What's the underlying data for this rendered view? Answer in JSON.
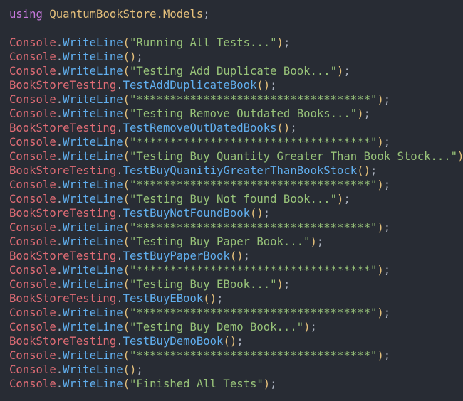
{
  "editor": {
    "colors": {
      "background": "#282c34",
      "keyword": "#c678dd",
      "namespace": "#e5c07b",
      "class": "#e06c75",
      "method": "#61afef",
      "string": "#98c379",
      "paren": "#e5c07b",
      "plain": "#abb2bf"
    },
    "lines": [
      {
        "tokens": [
          [
            "kw",
            "using"
          ],
          [
            "punc",
            " "
          ],
          [
            "ns",
            "QuantumBookStore.Models"
          ],
          [
            "punc",
            ";"
          ]
        ]
      },
      {
        "tokens": []
      },
      {
        "tokens": [
          [
            "cls",
            "Console"
          ],
          [
            "punc",
            "."
          ],
          [
            "fn",
            "WriteLine"
          ],
          [
            "paren",
            "("
          ],
          [
            "str",
            "\"Running All Tests...\""
          ],
          [
            "paren",
            ")"
          ],
          [
            "punc",
            ";"
          ]
        ]
      },
      {
        "tokens": [
          [
            "cls",
            "Console"
          ],
          [
            "punc",
            "."
          ],
          [
            "fn",
            "WriteLine"
          ],
          [
            "paren",
            "()"
          ],
          [
            "punc",
            ";"
          ]
        ]
      },
      {
        "tokens": [
          [
            "cls",
            "Console"
          ],
          [
            "punc",
            "."
          ],
          [
            "fn",
            "WriteLine"
          ],
          [
            "paren",
            "("
          ],
          [
            "str",
            "\"Testing Add Duplicate Book...\""
          ],
          [
            "paren",
            ")"
          ],
          [
            "punc",
            ";"
          ]
        ]
      },
      {
        "tokens": [
          [
            "cls",
            "BookStoreTesting"
          ],
          [
            "punc",
            "."
          ],
          [
            "fn",
            "TestAddDuplicateBook"
          ],
          [
            "paren",
            "()"
          ],
          [
            "punc",
            ";"
          ]
        ]
      },
      {
        "tokens": [
          [
            "cls",
            "Console"
          ],
          [
            "punc",
            "."
          ],
          [
            "fn",
            "WriteLine"
          ],
          [
            "paren",
            "("
          ],
          [
            "str",
            "\"***********************************\""
          ],
          [
            "paren",
            ")"
          ],
          [
            "punc",
            ";"
          ]
        ]
      },
      {
        "tokens": [
          [
            "cls",
            "Console"
          ],
          [
            "punc",
            "."
          ],
          [
            "fn",
            "WriteLine"
          ],
          [
            "paren",
            "("
          ],
          [
            "str",
            "\"Testing Remove Outdated Books...\""
          ],
          [
            "paren",
            ")"
          ],
          [
            "punc",
            ";"
          ]
        ]
      },
      {
        "tokens": [
          [
            "cls",
            "BookStoreTesting"
          ],
          [
            "punc",
            "."
          ],
          [
            "fn",
            "TestRemoveOutDatedBooks"
          ],
          [
            "paren",
            "()"
          ],
          [
            "punc",
            ";"
          ]
        ]
      },
      {
        "tokens": [
          [
            "cls",
            "Console"
          ],
          [
            "punc",
            "."
          ],
          [
            "fn",
            "WriteLine"
          ],
          [
            "paren",
            "("
          ],
          [
            "str",
            "\"***********************************\""
          ],
          [
            "paren",
            ")"
          ],
          [
            "punc",
            ";"
          ]
        ]
      },
      {
        "tokens": [
          [
            "cls",
            "Console"
          ],
          [
            "punc",
            "."
          ],
          [
            "fn",
            "WriteLine"
          ],
          [
            "paren",
            "("
          ],
          [
            "str",
            "\"Testing Buy Quantity Greater Than Book Stock...\""
          ],
          [
            "paren",
            ")"
          ],
          [
            "punc",
            ";"
          ]
        ]
      },
      {
        "tokens": [
          [
            "cls",
            "BookStoreTesting"
          ],
          [
            "punc",
            "."
          ],
          [
            "fn",
            "TestBuyQuanitiyGreaterThanBookStock"
          ],
          [
            "paren",
            "()"
          ],
          [
            "punc",
            ";"
          ]
        ]
      },
      {
        "tokens": [
          [
            "cls",
            "Console"
          ],
          [
            "punc",
            "."
          ],
          [
            "fn",
            "WriteLine"
          ],
          [
            "paren",
            "("
          ],
          [
            "str",
            "\"***********************************\""
          ],
          [
            "paren",
            ")"
          ],
          [
            "punc",
            ";"
          ]
        ]
      },
      {
        "tokens": [
          [
            "cls",
            "Console"
          ],
          [
            "punc",
            "."
          ],
          [
            "fn",
            "WriteLine"
          ],
          [
            "paren",
            "("
          ],
          [
            "str",
            "\"Testing Buy Not found Book...\""
          ],
          [
            "paren",
            ")"
          ],
          [
            "punc",
            ";"
          ]
        ]
      },
      {
        "tokens": [
          [
            "cls",
            "BookStoreTesting"
          ],
          [
            "punc",
            "."
          ],
          [
            "fn",
            "TestBuyNotFoundBook"
          ],
          [
            "paren",
            "()"
          ],
          [
            "punc",
            ";"
          ]
        ]
      },
      {
        "tokens": [
          [
            "cls",
            "Console"
          ],
          [
            "punc",
            "."
          ],
          [
            "fn",
            "WriteLine"
          ],
          [
            "paren",
            "("
          ],
          [
            "str",
            "\"***********************************\""
          ],
          [
            "paren",
            ")"
          ],
          [
            "punc",
            ";"
          ]
        ]
      },
      {
        "tokens": [
          [
            "cls",
            "Console"
          ],
          [
            "punc",
            "."
          ],
          [
            "fn",
            "WriteLine"
          ],
          [
            "paren",
            "("
          ],
          [
            "str",
            "\"Testing Buy Paper Book...\""
          ],
          [
            "paren",
            ")"
          ],
          [
            "punc",
            ";"
          ]
        ]
      },
      {
        "tokens": [
          [
            "cls",
            "BookStoreTesting"
          ],
          [
            "punc",
            "."
          ],
          [
            "fn",
            "TestBuyPaperBook"
          ],
          [
            "paren",
            "()"
          ],
          [
            "punc",
            ";"
          ]
        ]
      },
      {
        "tokens": [
          [
            "cls",
            "Console"
          ],
          [
            "punc",
            "."
          ],
          [
            "fn",
            "WriteLine"
          ],
          [
            "paren",
            "("
          ],
          [
            "str",
            "\"***********************************\""
          ],
          [
            "paren",
            ")"
          ],
          [
            "punc",
            ";"
          ]
        ]
      },
      {
        "tokens": [
          [
            "cls",
            "Console"
          ],
          [
            "punc",
            "."
          ],
          [
            "fn",
            "WriteLine"
          ],
          [
            "paren",
            "("
          ],
          [
            "str",
            "\"Testing Buy EBook...\""
          ],
          [
            "paren",
            ")"
          ],
          [
            "punc",
            ";"
          ]
        ]
      },
      {
        "tokens": [
          [
            "cls",
            "BookStoreTesting"
          ],
          [
            "punc",
            "."
          ],
          [
            "fn",
            "TestBuyEBook"
          ],
          [
            "paren",
            "()"
          ],
          [
            "punc",
            ";"
          ]
        ]
      },
      {
        "tokens": [
          [
            "cls",
            "Console"
          ],
          [
            "punc",
            "."
          ],
          [
            "fn",
            "WriteLine"
          ],
          [
            "paren",
            "("
          ],
          [
            "str",
            "\"***********************************\""
          ],
          [
            "paren",
            ")"
          ],
          [
            "punc",
            ";"
          ]
        ]
      },
      {
        "tokens": [
          [
            "cls",
            "Console"
          ],
          [
            "punc",
            "."
          ],
          [
            "fn",
            "WriteLine"
          ],
          [
            "paren",
            "("
          ],
          [
            "str",
            "\"Testing Buy Demo Book...\""
          ],
          [
            "paren",
            ")"
          ],
          [
            "punc",
            ";"
          ]
        ]
      },
      {
        "tokens": [
          [
            "cls",
            "BookStoreTesting"
          ],
          [
            "punc",
            "."
          ],
          [
            "fn",
            "TestBuyDemoBook"
          ],
          [
            "paren",
            "()"
          ],
          [
            "punc",
            ";"
          ]
        ]
      },
      {
        "tokens": [
          [
            "cls",
            "Console"
          ],
          [
            "punc",
            "."
          ],
          [
            "fn",
            "WriteLine"
          ],
          [
            "paren",
            "("
          ],
          [
            "str",
            "\"***********************************\""
          ],
          [
            "paren",
            ")"
          ],
          [
            "punc",
            ";"
          ]
        ]
      },
      {
        "tokens": [
          [
            "cls",
            "Console"
          ],
          [
            "punc",
            "."
          ],
          [
            "fn",
            "WriteLine"
          ],
          [
            "paren",
            "()"
          ],
          [
            "punc",
            ";"
          ]
        ]
      },
      {
        "tokens": [
          [
            "cls",
            "Console"
          ],
          [
            "punc",
            "."
          ],
          [
            "fn",
            "WriteLine"
          ],
          [
            "paren",
            "("
          ],
          [
            "str",
            "\"Finished All Tests\""
          ],
          [
            "paren",
            ")"
          ],
          [
            "punc",
            ";"
          ]
        ]
      }
    ]
  }
}
